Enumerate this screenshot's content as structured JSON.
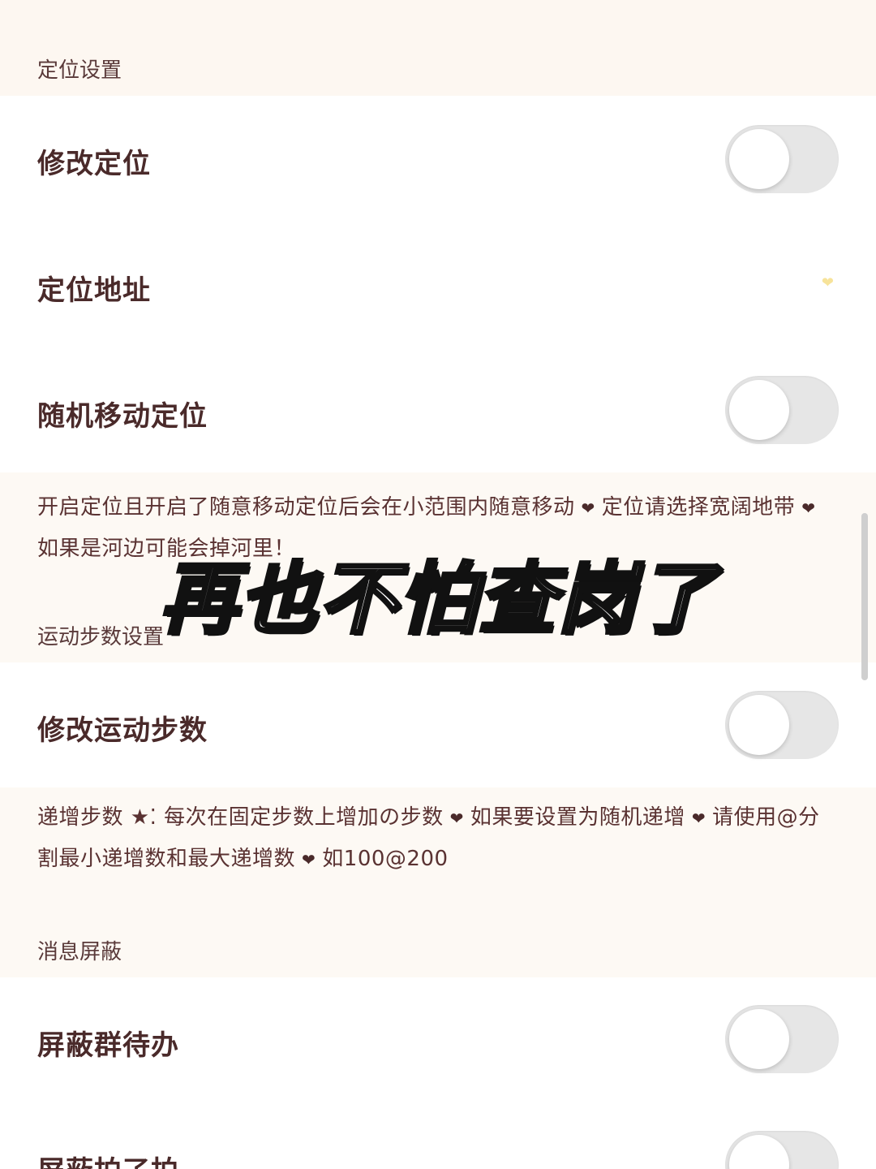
{
  "sections": {
    "location": {
      "header": "定位设置",
      "modify_location": {
        "label": "修改定位",
        "enabled": false
      },
      "location_address": {
        "label": "定位地址"
      },
      "random_move": {
        "label": "随机移动定位",
        "enabled": false
      },
      "note_part1": "开启定位且开启了随意移动定位后会在小范围内随意移动",
      "note_part2": "定位请选择宽阔地带",
      "note_part3": "如果是河边可能会掉河里！"
    },
    "steps": {
      "header": "运动步数设置",
      "modify_steps": {
        "label": "修改运动步数",
        "enabled": false
      },
      "note_part1": "递增步数 ★⁚ 每次在固定步数上增加の步数",
      "note_part2": "如果要设置为随机递增",
      "note_part3": "请使用@分割最小递增数和最大递增数",
      "note_part4": "如100@200"
    },
    "messages": {
      "header": "消息屏蔽",
      "block_group_todo": {
        "label": "屏蔽群待办",
        "enabled": false
      },
      "block_pat": {
        "label": "屏蔽拍了拍",
        "enabled": false
      }
    }
  },
  "overlay_caption": "再也不怕查岗了",
  "icons": {
    "heart_separator": "heart-icon",
    "address_indicator": "yellow-heart-icon"
  },
  "colors": {
    "header_bg": "#fdf7f1",
    "text_primary": "#4a2a2a",
    "toggle_off": "#e6e6e6",
    "address_heart": "#f7e39a"
  }
}
